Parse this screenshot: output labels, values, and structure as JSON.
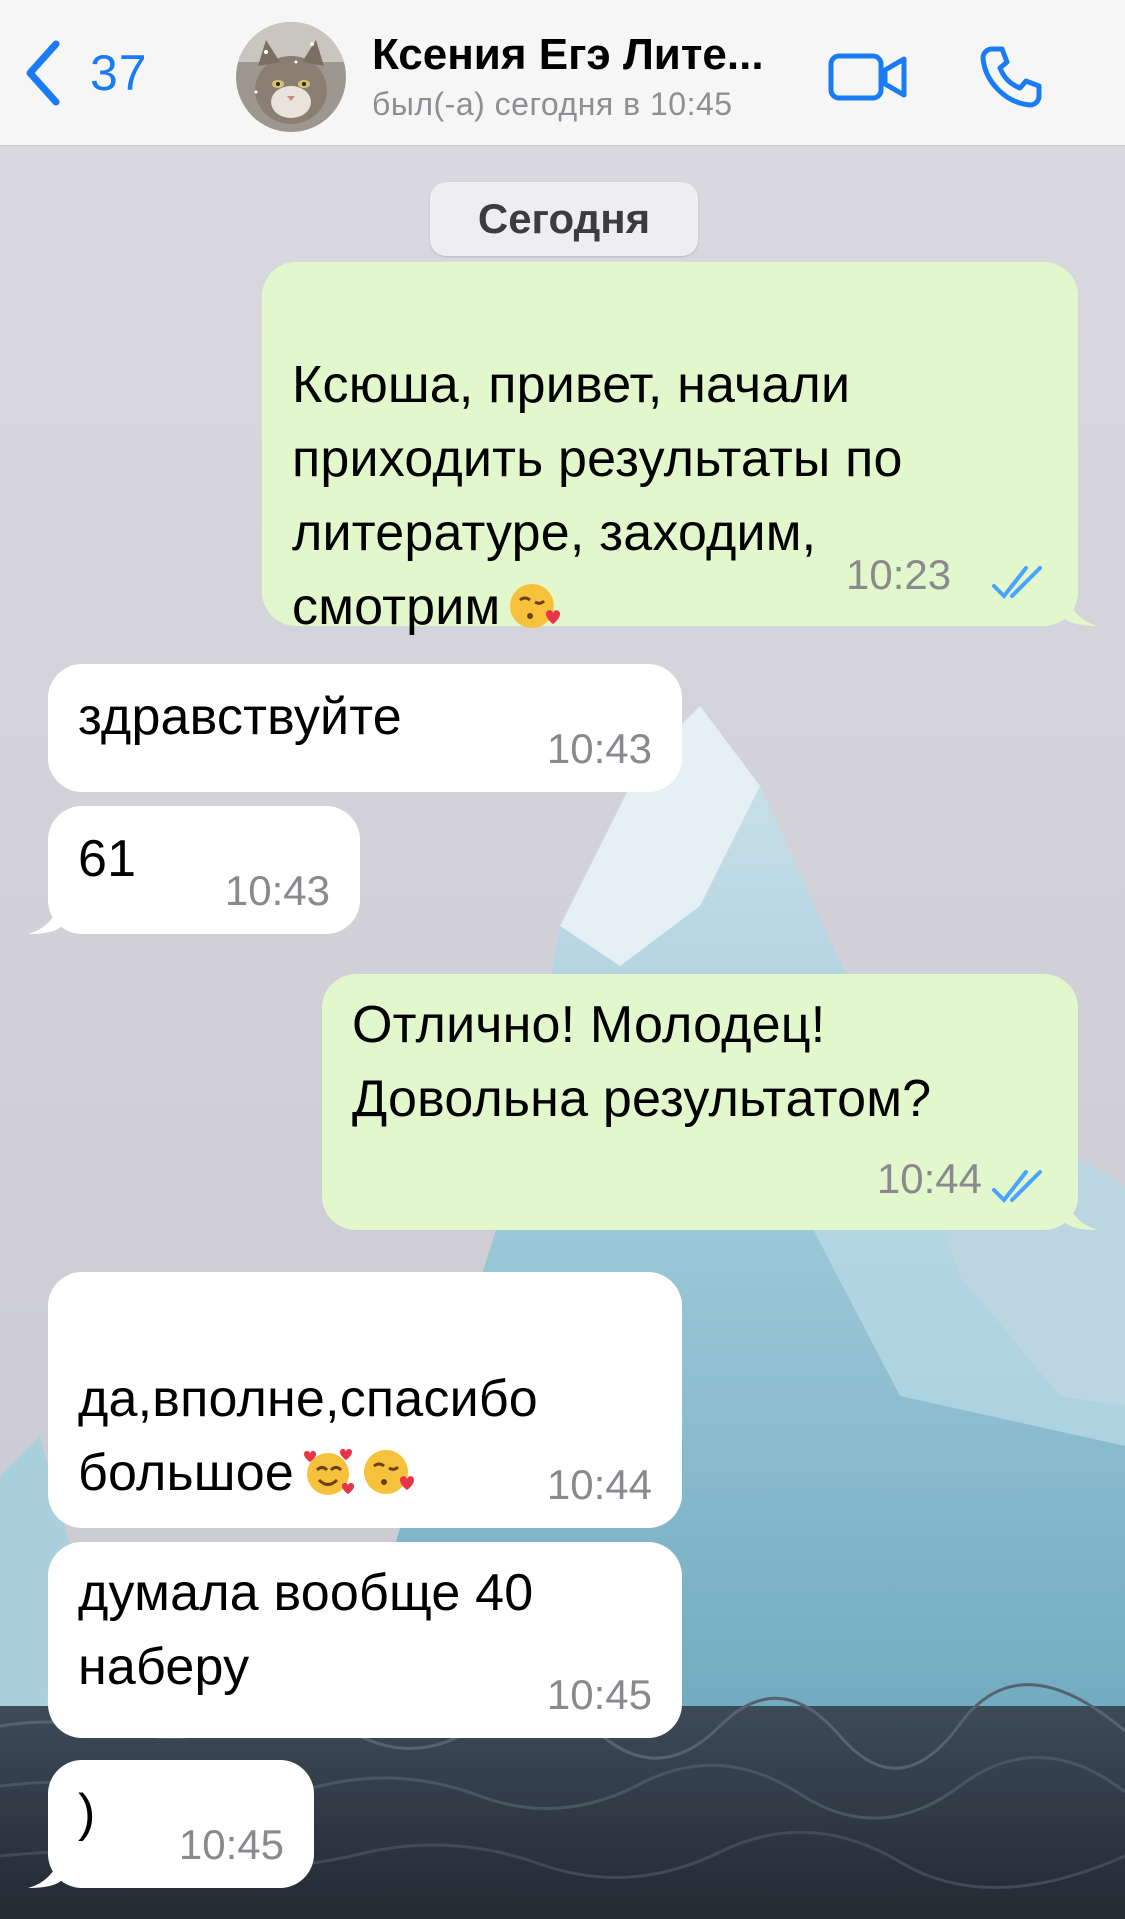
{
  "header": {
    "back_count": "37",
    "contact_name": "Ксения Егэ Лите...",
    "status": "был(-а) сегодня в 10:45"
  },
  "chat": {
    "date_label": "Сегодня",
    "messages": [
      {
        "direction": "out",
        "text": "Ксюша, привет, начали\nприходить результаты по\nлитературе, заходим,\nсмотрим",
        "emoji": "kissing-heart",
        "time": "10:23",
        "read": true
      },
      {
        "direction": "in",
        "text": "здравствуйте",
        "time": "10:43"
      },
      {
        "direction": "in",
        "text": "61",
        "time": "10:43"
      },
      {
        "direction": "out",
        "text": "Отлично! Молодец!\nДовольна результатом?",
        "time": "10:44",
        "read": true
      },
      {
        "direction": "in",
        "text": "да,вполне,спасибо\nбольшое",
        "emoji": "smiling-hearts kissing-heart",
        "time": "10:44"
      },
      {
        "direction": "in",
        "text": "думала вообще 40\nнаберу",
        "time": "10:45"
      },
      {
        "direction": "in",
        "text": ")",
        "time": "10:45"
      }
    ]
  },
  "colors": {
    "accent": "#1a7cf5",
    "outgoing_bubble": "#e2f7cb",
    "incoming_bubble": "#ffffff",
    "read_ticks": "#4aa3ff"
  }
}
